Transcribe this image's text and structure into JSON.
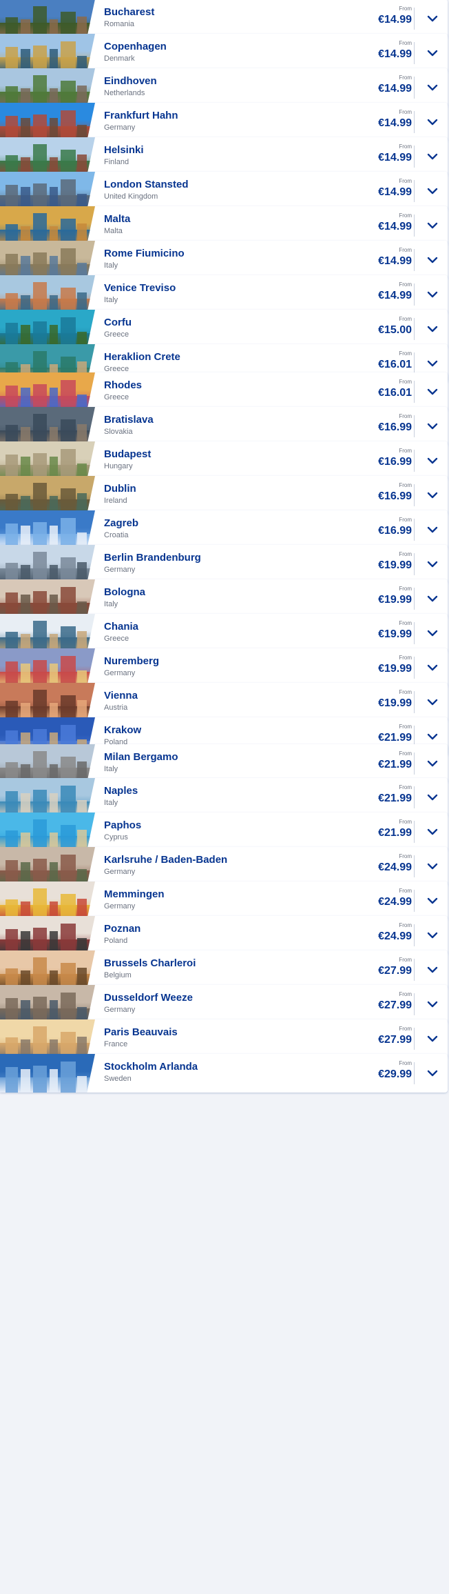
{
  "from_label": "From",
  "destinations": [
    {
      "city": "Bucharest",
      "country": "Romania",
      "price": "€14.99",
      "image": "castle-towers",
      "colors": [
        "#4a7fc1",
        "#3d5a2a",
        "#8a6a4a"
      ]
    },
    {
      "city": "Copenhagen",
      "country": "Denmark",
      "price": "€14.99",
      "image": "colorful-harbor-houses",
      "colors": [
        "#9fc4e6",
        "#c9a24a",
        "#2f5d7a"
      ]
    },
    {
      "city": "Eindhoven",
      "country": "Netherlands",
      "price": "€14.99",
      "image": "church-tower",
      "colors": [
        "#a9c6e0",
        "#4f7a3a",
        "#7a6a5a"
      ]
    },
    {
      "city": "Frankfurt Hahn",
      "country": "Germany",
      "price": "€14.99",
      "image": "half-timbered-houses",
      "colors": [
        "#2a8ae0",
        "#b04a3a",
        "#6a4a3a"
      ]
    },
    {
      "city": "Helsinki",
      "country": "Finland",
      "price": "€14.99",
      "image": "city-street",
      "colors": [
        "#b8d2ea",
        "#3a7a4a",
        "#8a4a3a"
      ]
    },
    {
      "city": "London Stansted",
      "country": "United Kingdom",
      "price": "€14.99",
      "image": "tower-bridge",
      "colors": [
        "#7fb8e8",
        "#5a6a7a",
        "#3a5a8a"
      ]
    },
    {
      "city": "Malta",
      "country": "Malta",
      "price": "€14.99",
      "image": "harbor-boats",
      "colors": [
        "#d8a84a",
        "#2a6a9a",
        "#c88a3a"
      ]
    },
    {
      "city": "Rome Fiumicino",
      "country": "Italy",
      "price": "€14.99",
      "image": "fountain-palace",
      "colors": [
        "#c8b89a",
        "#8a7a5a",
        "#5a7a9a"
      ]
    },
    {
      "city": "Venice Treviso",
      "country": "Italy",
      "price": "€14.99",
      "image": "canal-city",
      "colors": [
        "#a8c8e0",
        "#c87a4a",
        "#3a6a8a"
      ]
    },
    {
      "city": "Corfu",
      "country": "Greece",
      "price": "€15.00",
      "image": "turquoise-bay",
      "colors": [
        "#2aa8c8",
        "#1a7a9a",
        "#3a6a2a"
      ]
    },
    {
      "city": "Heraklion Crete",
      "country": "Greece",
      "price": "€16.01",
      "image": "harbor-town",
      "colors": [
        "#3a9aa8",
        "#2a7a6a",
        "#c8a87a"
      ]
    },
    {
      "city": "Rhodes",
      "country": "Greece",
      "price": "€16.01",
      "image": "colorful-buildings",
      "colors": [
        "#e8a84a",
        "#c84a5a",
        "#4a6ac8"
      ]
    },
    {
      "city": "Bratislava",
      "country": "Slovakia",
      "price": "€16.99",
      "image": "old-town-hill",
      "colors": [
        "#5a6a7a",
        "#3a4a5a",
        "#8a7a6a"
      ]
    },
    {
      "city": "Budapest",
      "country": "Hungary",
      "price": "€16.99",
      "image": "fishermans-bastion",
      "colors": [
        "#d8d0b8",
        "#a89a7a",
        "#6a8a4a"
      ]
    },
    {
      "city": "Dublin",
      "country": "Ireland",
      "price": "€16.99",
      "image": "bridge-river",
      "colors": [
        "#c8a86a",
        "#6a5a3a",
        "#4a6a5a"
      ]
    },
    {
      "city": "Zagreb",
      "country": "Croatia",
      "price": "€16.99",
      "image": "airplane-sky",
      "colors": [
        "#3a7ac8",
        "#7ab0e8",
        "#e8eef8"
      ]
    },
    {
      "city": "Berlin Brandenburg",
      "country": "Germany",
      "price": "€19.99",
      "image": "city-skyline",
      "colors": [
        "#c8d8e8",
        "#7a8a9a",
        "#4a5a6a"
      ]
    },
    {
      "city": "Bologna",
      "country": "Italy",
      "price": "€19.99",
      "image": "rooftops-towers",
      "colors": [
        "#d8c8b8",
        "#8a4a3a",
        "#6a5a4a"
      ]
    },
    {
      "city": "Chania",
      "country": "Greece",
      "price": "€19.99",
      "image": "harbor-waterfront",
      "colors": [
        "#e8eef4",
        "#3a6a8a",
        "#c8a87a"
      ]
    },
    {
      "city": "Nuremberg",
      "country": "Germany",
      "price": "€19.99",
      "image": "colorful-facades",
      "colors": [
        "#8a9ac8",
        "#c84a4a",
        "#e8c87a"
      ]
    },
    {
      "city": "Vienna",
      "country": "Austria",
      "price": "€19.99",
      "image": "cathedral-sunset",
      "colors": [
        "#c87a5a",
        "#6a3a2a",
        "#e8a87a"
      ]
    },
    {
      "city": "Krakow",
      "country": "Poland",
      "price": "€21.99",
      "image": "church-towers",
      "colors": [
        "#2a5ab8",
        "#4a7ad8",
        "#c8a87a"
      ]
    },
    {
      "city": "Milan Bergamo",
      "country": "Italy",
      "price": "€21.99",
      "image": "gothic-cathedral",
      "colors": [
        "#b8c8d8",
        "#8a8a8a",
        "#6a6a6a"
      ]
    },
    {
      "city": "Naples",
      "country": "Italy",
      "price": "€21.99",
      "image": "bay-volcano",
      "colors": [
        "#a8c8e0",
        "#3a8ab8",
        "#d8d0c0"
      ]
    },
    {
      "city": "Paphos",
      "country": "Cyprus",
      "price": "€21.99",
      "image": "coast-cliffs",
      "colors": [
        "#4ab8e8",
        "#2a9ad8",
        "#d8c89a"
      ]
    },
    {
      "city": "Karlsruhe / Baden-Baden",
      "country": "Germany",
      "price": "€24.99",
      "image": "town-hills",
      "colors": [
        "#c8b8a8",
        "#8a5a4a",
        "#5a6a4a"
      ]
    },
    {
      "city": "Memmingen",
      "country": "Germany",
      "price": "€24.99",
      "image": "colorful-gables",
      "colors": [
        "#e8e0d8",
        "#e8b83a",
        "#c84a3a"
      ]
    },
    {
      "city": "Poznan",
      "country": "Poland",
      "price": "€24.99",
      "image": "market-square",
      "colors": [
        "#e8e0d8",
        "#8a3a3a",
        "#3a3a3a"
      ]
    },
    {
      "city": "Brussels Charleroi",
      "country": "Belgium",
      "price": "€27.99",
      "image": "grand-place",
      "colors": [
        "#e8c8a8",
        "#c88a4a",
        "#6a4a2a"
      ]
    },
    {
      "city": "Dusseldorf Weeze",
      "country": "Germany",
      "price": "€27.99",
      "image": "ferris-wheel",
      "colors": [
        "#c8b8a8",
        "#7a6a5a",
        "#4a5a6a"
      ]
    },
    {
      "city": "Paris Beauvais",
      "country": "France",
      "price": "€27.99",
      "image": "louvre-pyramid",
      "colors": [
        "#f0d8a8",
        "#d8a86a",
        "#8a7a6a"
      ]
    },
    {
      "city": "Stockholm Arlanda",
      "country": "Sweden",
      "price": "€29.99",
      "image": "airplane-sky",
      "colors": [
        "#2a6ab8",
        "#6aa0d8",
        "#e8eef8"
      ]
    }
  ]
}
